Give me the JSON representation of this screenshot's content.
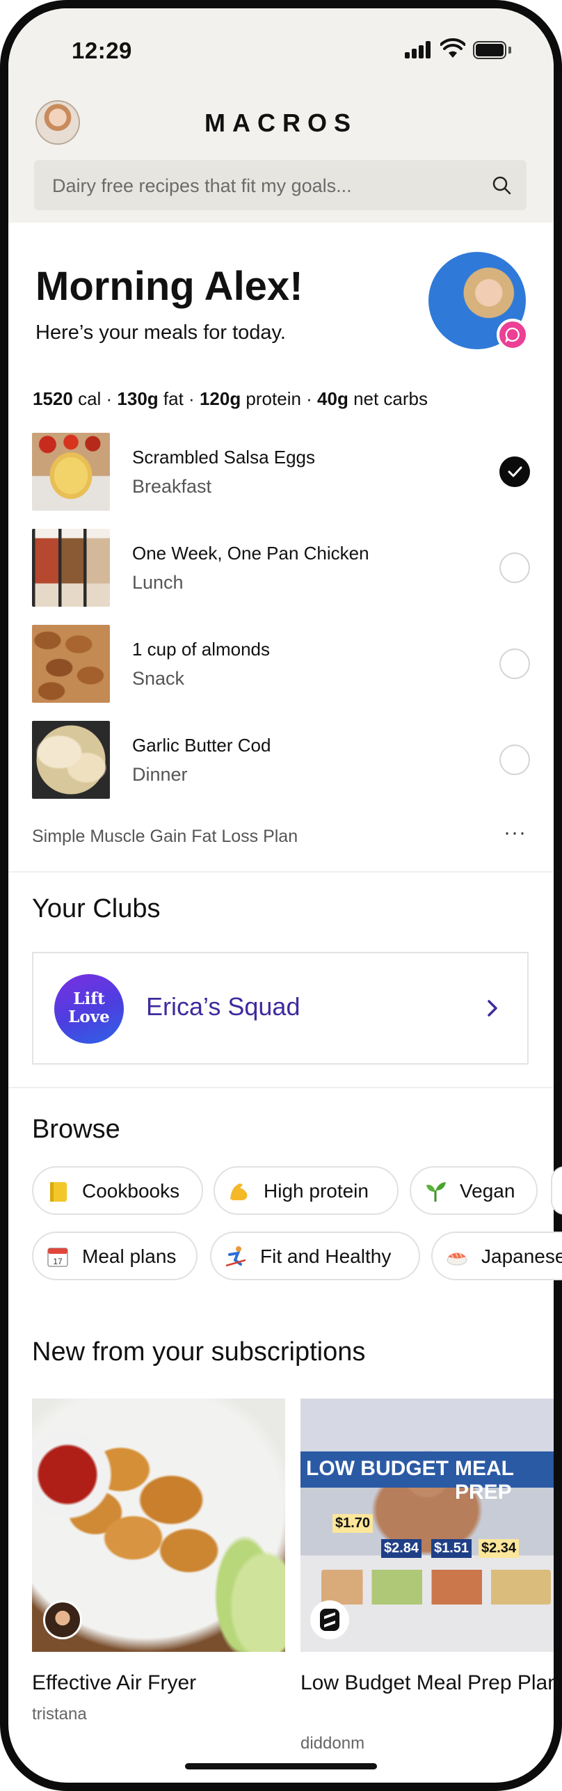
{
  "status_bar": {
    "time": "12:29"
  },
  "header": {
    "app_title": "MACROS",
    "search_placeholder": "Dairy free recipes that fit my goals..."
  },
  "greeting": {
    "title": "Morning Alex!",
    "subtitle": "Here’s your meals for today."
  },
  "macros": {
    "cal_value": "1520",
    "cal_unit": " cal · ",
    "fat_value": "130g",
    "fat_unit": " fat · ",
    "protein_value": "120g",
    "protein_unit": " protein · ",
    "carbs_value": "40g",
    "carbs_unit": " net carbs"
  },
  "meals": [
    {
      "name": "Scrambled Salsa Eggs",
      "kind": "Breakfast",
      "done": true
    },
    {
      "name": "One Week, One Pan Chicken",
      "kind": "Lunch",
      "done": false
    },
    {
      "name": "1 cup of almonds",
      "kind": "Snack",
      "done": false
    },
    {
      "name": "Garlic Butter Cod",
      "kind": "Dinner",
      "done": false
    }
  ],
  "plan": {
    "name": "Simple Muscle Gain Fat Loss Plan"
  },
  "clubs": {
    "title": "Your Clubs",
    "club_name": "Erica’s Squad",
    "logo_line1": "Lift",
    "logo_line2": "Love"
  },
  "browse": {
    "title": "Browse",
    "chips": [
      {
        "label": "Cookbooks",
        "icon": "notebook-icon"
      },
      {
        "label": "High protein",
        "icon": "flexed-arm-icon"
      },
      {
        "label": "Vegan",
        "icon": "seedling-icon"
      },
      {
        "label": "Meal plans",
        "icon": "calendar-icon"
      },
      {
        "label": "Fit and Healthy",
        "icon": "skier-icon"
      },
      {
        "label": "Japanese",
        "icon": "sushi-icon"
      }
    ]
  },
  "subscriptions": {
    "title": "New from your subscriptions",
    "items": [
      {
        "title": "Effective Air Fryer",
        "author": "tristana"
      },
      {
        "title": "Low Budget Meal Prep Plan",
        "author": "diddonm",
        "banner_left": "LOW BUDGET",
        "banner_right": "MEAL PREP",
        "prices": [
          "$1.70",
          "$2.84",
          "$1.51",
          "$2.34"
        ]
      }
    ]
  },
  "colors": {
    "accent_purple": "#3f2a9d",
    "badge_pink": "#ec3f95",
    "coach_blue": "#2f79d8"
  }
}
